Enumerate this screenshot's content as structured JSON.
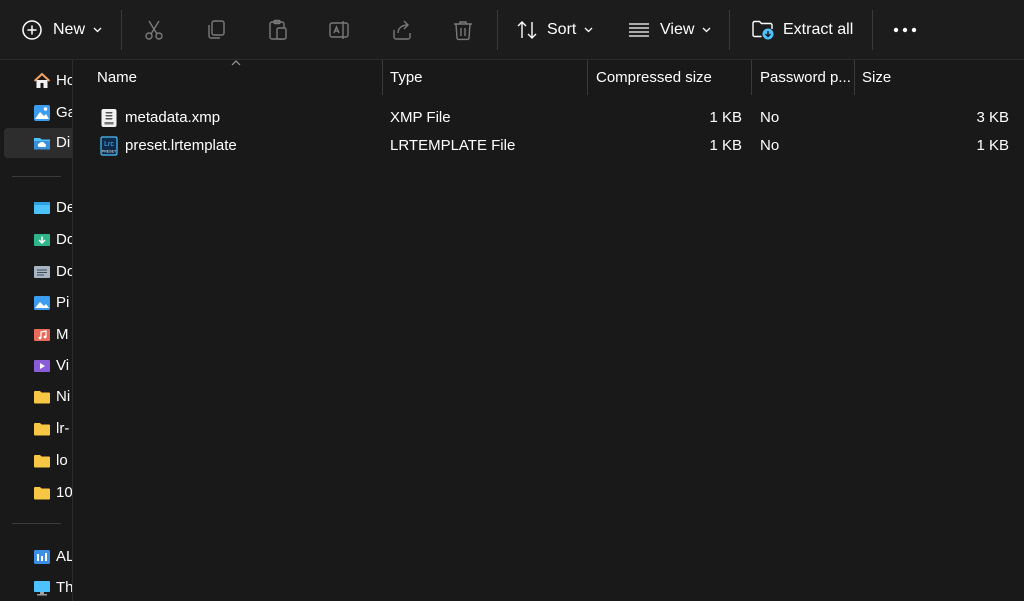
{
  "toolbar": {
    "new_label": "New",
    "sort_label": "Sort",
    "view_label": "View",
    "extract_label": "Extract all"
  },
  "sidebar": {
    "items": [
      {
        "label": "Ho",
        "icon": "home-icon"
      },
      {
        "label": "Ga",
        "icon": "gallery-icon"
      },
      {
        "label": "Di",
        "icon": "onedrive-icon"
      },
      {
        "label": "De",
        "icon": "desktop-folder-icon"
      },
      {
        "label": "Do",
        "icon": "downloads-folder-icon"
      },
      {
        "label": "Do",
        "icon": "documents-folder-icon"
      },
      {
        "label": "Pi",
        "icon": "pictures-folder-icon"
      },
      {
        "label": "M",
        "icon": "music-folder-icon"
      },
      {
        "label": "Vi",
        "icon": "videos-folder-icon"
      },
      {
        "label": "Ni",
        "icon": "folder-icon"
      },
      {
        "label": "lr-",
        "icon": "folder-icon"
      },
      {
        "label": "lo",
        "icon": "folder-icon"
      },
      {
        "label": "10",
        "icon": "folder-icon"
      },
      {
        "label": "AL",
        "icon": "drive-icon"
      },
      {
        "label": "Th",
        "icon": "this-pc-icon"
      }
    ]
  },
  "table": {
    "columns": [
      "Name",
      "Type",
      "Compressed size",
      "Password p...",
      "Size"
    ],
    "rows": [
      {
        "name": "metadata.xmp",
        "type": "XMP File",
        "compressed": "1 KB",
        "password": "No",
        "size": "3 KB",
        "icon": "xmp-file-icon"
      },
      {
        "name": "preset.lrtemplate",
        "type": "LRTEMPLATE File",
        "compressed": "1 KB",
        "password": "No",
        "size": "1 KB",
        "icon": "lrc-preset-file-icon",
        "icon_text_top": "Lrc",
        "icon_text_bottom": "PRESET"
      }
    ]
  },
  "colors": {
    "background": "#191919",
    "accent_blue": "#4cc2ff",
    "folder_yellow": "#f8c645"
  }
}
